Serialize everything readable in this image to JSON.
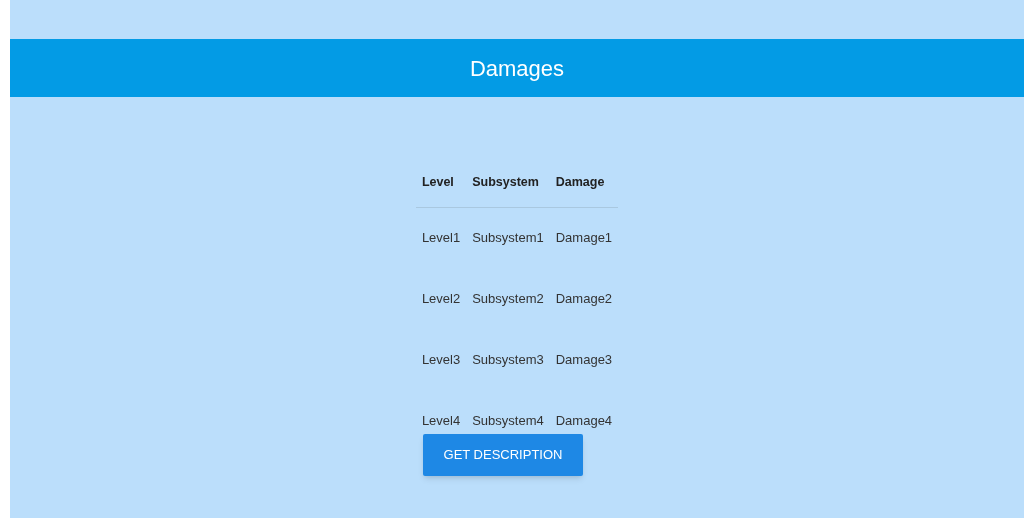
{
  "header": {
    "title": "Damages"
  },
  "table": {
    "columns": [
      "Level",
      "Subsystem",
      "Damage"
    ],
    "rows": [
      [
        "Level1",
        "Subsystem1",
        "Damage1"
      ],
      [
        "Level2",
        "Subsystem2",
        "Damage2"
      ],
      [
        "Level3",
        "Subsystem3",
        "Damage3"
      ],
      [
        "Level4",
        "Subsystem4",
        "Damage4"
      ]
    ]
  },
  "button": {
    "label": "GET DESCRIPTION"
  }
}
